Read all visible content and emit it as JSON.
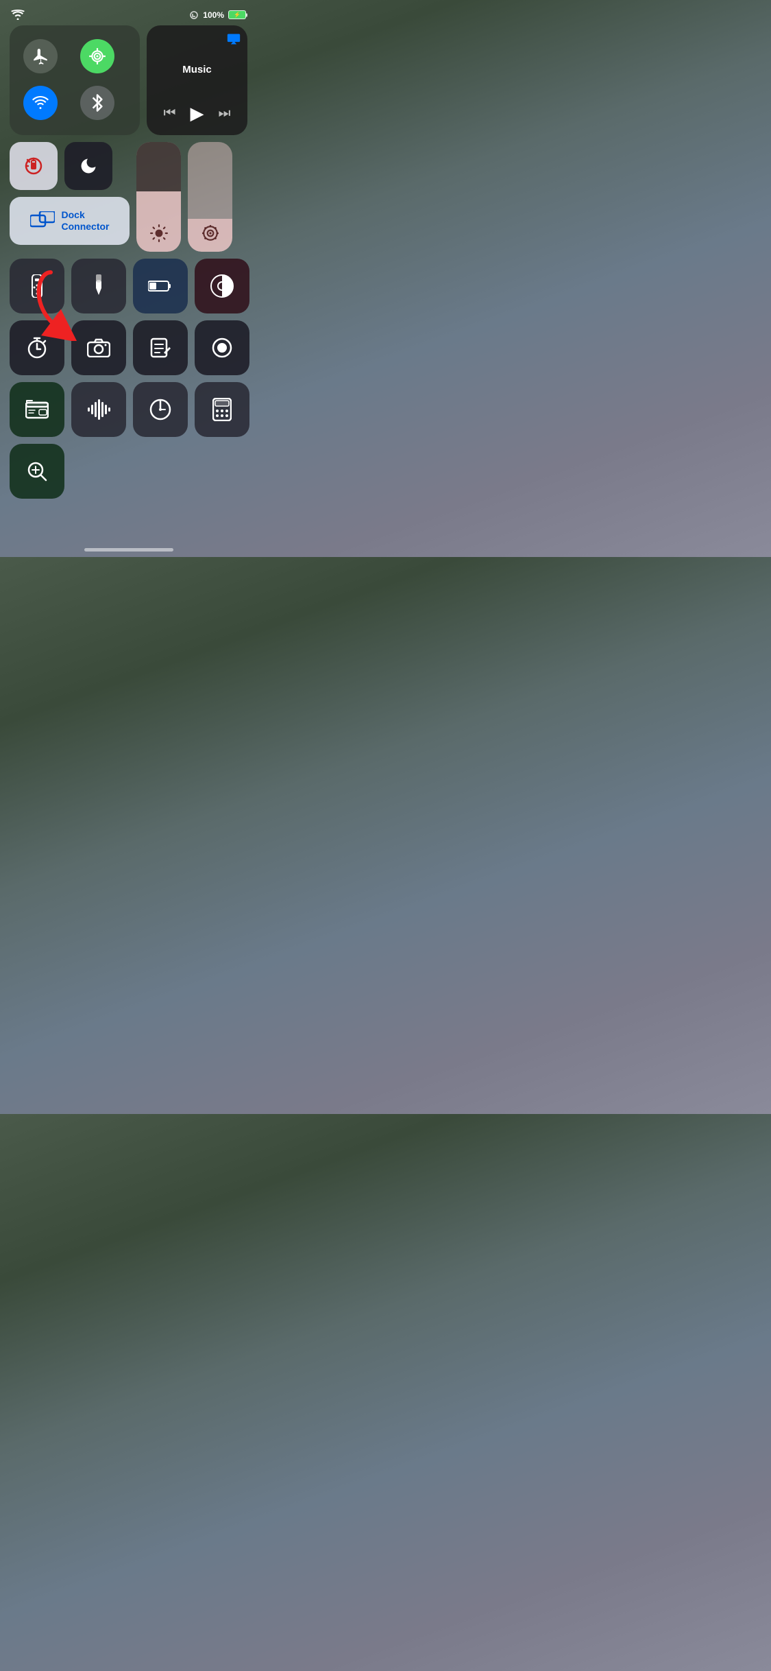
{
  "status": {
    "battery_percent": "100%",
    "wifi": true
  },
  "music": {
    "title": "Music",
    "airplay_icon": "📡"
  },
  "connectivity": {
    "airplane_label": "airplane-mode",
    "cellular_label": "cellular",
    "wifi_label": "wifi",
    "bluetooth_label": "bluetooth"
  },
  "toggles": {
    "rotation_lock": "rotation-lock",
    "do_not_disturb": "do-not-disturb",
    "dock_connector": "Dock\nConnector"
  },
  "dock_connector": {
    "label_line1": "Dock",
    "label_line2": "Connector"
  },
  "grid_row1": [
    {
      "id": "remote",
      "icon": "remote"
    },
    {
      "id": "flashlight",
      "icon": "flashlight"
    },
    {
      "id": "low-battery",
      "icon": "battery"
    },
    {
      "id": "accessibility",
      "icon": "contrast"
    }
  ],
  "grid_row2": [
    {
      "id": "timer",
      "icon": "timer"
    },
    {
      "id": "camera",
      "icon": "camera"
    },
    {
      "id": "notes",
      "icon": "notes"
    },
    {
      "id": "voice-memo",
      "icon": "record"
    }
  ],
  "grid_row3": [
    {
      "id": "wallet",
      "icon": "wallet"
    },
    {
      "id": "sound",
      "icon": "soundwave"
    },
    {
      "id": "clock",
      "icon": "clock"
    },
    {
      "id": "calculator",
      "icon": "calculator"
    }
  ],
  "grid_row4": [
    {
      "id": "search",
      "icon": "search"
    }
  ]
}
